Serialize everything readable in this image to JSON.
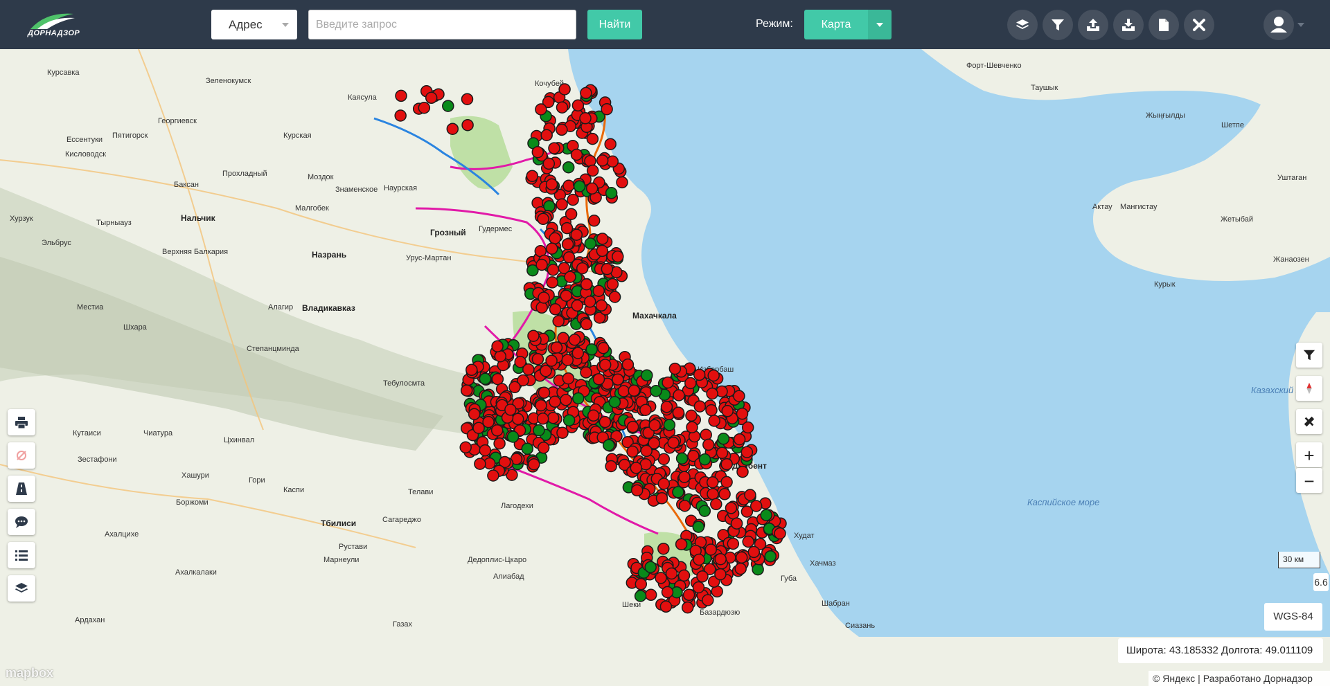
{
  "header": {
    "logo_text": "ДОРНАДЗОР",
    "search_type": "Адрес",
    "search_placeholder": "Введите запрос",
    "search_value": "",
    "find_label": "Найти",
    "mode_label": "Режим:",
    "mode_value": "Карта",
    "tools": [
      "layers-icon",
      "filter-icon",
      "upload-icon",
      "download-icon",
      "document-icon",
      "tools-icon"
    ]
  },
  "map": {
    "labels": [
      {
        "text": "Курсавка"
      },
      {
        "text": "Зеленокумск"
      },
      {
        "text": "Каясула"
      },
      {
        "text": "Кочубей"
      },
      {
        "text": "Георгиевск"
      },
      {
        "text": "Пятигорск"
      },
      {
        "text": "Ессентуки"
      },
      {
        "text": "Кисловодск"
      },
      {
        "text": "Курская"
      },
      {
        "text": "Прохладный"
      },
      {
        "text": "Моздок"
      },
      {
        "text": "Знаменское"
      },
      {
        "text": "Наурская"
      },
      {
        "text": "Баксан"
      },
      {
        "text": "Нальчик"
      },
      {
        "text": "Малгобек"
      },
      {
        "text": "Грозный"
      },
      {
        "text": "Гудермес"
      },
      {
        "text": "Хурзук"
      },
      {
        "text": "Тырныауз"
      },
      {
        "text": "Эльбрус"
      },
      {
        "text": "Верхняя Балкария"
      },
      {
        "text": "Назрань"
      },
      {
        "text": "Урус-Мартан"
      },
      {
        "text": "Местиа"
      },
      {
        "text": "Алагир"
      },
      {
        "text": "Владикавказ"
      },
      {
        "text": "Шхара"
      },
      {
        "text": "Степанцминда"
      },
      {
        "text": "Махачкала"
      },
      {
        "text": "Избербаш"
      },
      {
        "text": "Дербент"
      },
      {
        "text": "Тебулосмта"
      },
      {
        "text": "Кутаиси"
      },
      {
        "text": "Чиатура"
      },
      {
        "text": "Цхинвал"
      },
      {
        "text": "Зестафони"
      },
      {
        "text": "Хашури"
      },
      {
        "text": "Гори"
      },
      {
        "text": "Каспи"
      },
      {
        "text": "Телави"
      },
      {
        "text": "Лагодехи"
      },
      {
        "text": "Боржоми"
      },
      {
        "text": "Сагареджо"
      },
      {
        "text": "Ахалцихе"
      },
      {
        "text": "Тбилиси"
      },
      {
        "text": "Рустави"
      },
      {
        "text": "Марнеули"
      },
      {
        "text": "Ахалкалаки"
      },
      {
        "text": "Дедоплис-Цкаро"
      },
      {
        "text": "Алиабад"
      },
      {
        "text": "Шеки"
      },
      {
        "text": "Базардюзю"
      },
      {
        "text": "Худат"
      },
      {
        "text": "Хачмаз"
      },
      {
        "text": "Губа"
      },
      {
        "text": "Шабран"
      },
      {
        "text": "Сиазань"
      },
      {
        "text": "Газах"
      },
      {
        "text": "Ардахан"
      },
      {
        "text": "Форт-Шевченко"
      },
      {
        "text": "Таушык"
      },
      {
        "text": "Жыңғылды"
      },
      {
        "text": "Шетпе"
      },
      {
        "text": "Актау"
      },
      {
        "text": "Мангистау"
      },
      {
        "text": "Жетыбай"
      },
      {
        "text": "Уштаган"
      },
      {
        "text": "Жанаозен"
      },
      {
        "text": "Курык"
      },
      {
        "text": "Казахский залив"
      },
      {
        "text": "Каспийское море"
      }
    ],
    "marker_counts": {
      "red": 900,
      "green": 150
    }
  },
  "controls": {
    "zoom_in": "+",
    "zoom_out": "−",
    "scale_label": "30 км",
    "zoom_level": "6.6",
    "crs": "WGS-84",
    "latitude_label": "Широта:",
    "latitude": "43.185332",
    "longitude_label": "Долгота:",
    "longitude": "49.011109",
    "attribution": "© Яндекс | Разработано Дорнадзор",
    "mapbox": "mapbox"
  },
  "colors": {
    "marker_red": "#e20f0f",
    "marker_green": "#0a8a1a",
    "accent": "#42c9a8",
    "topbar": "#2e3a4a",
    "sea": "#a6d4ef"
  }
}
